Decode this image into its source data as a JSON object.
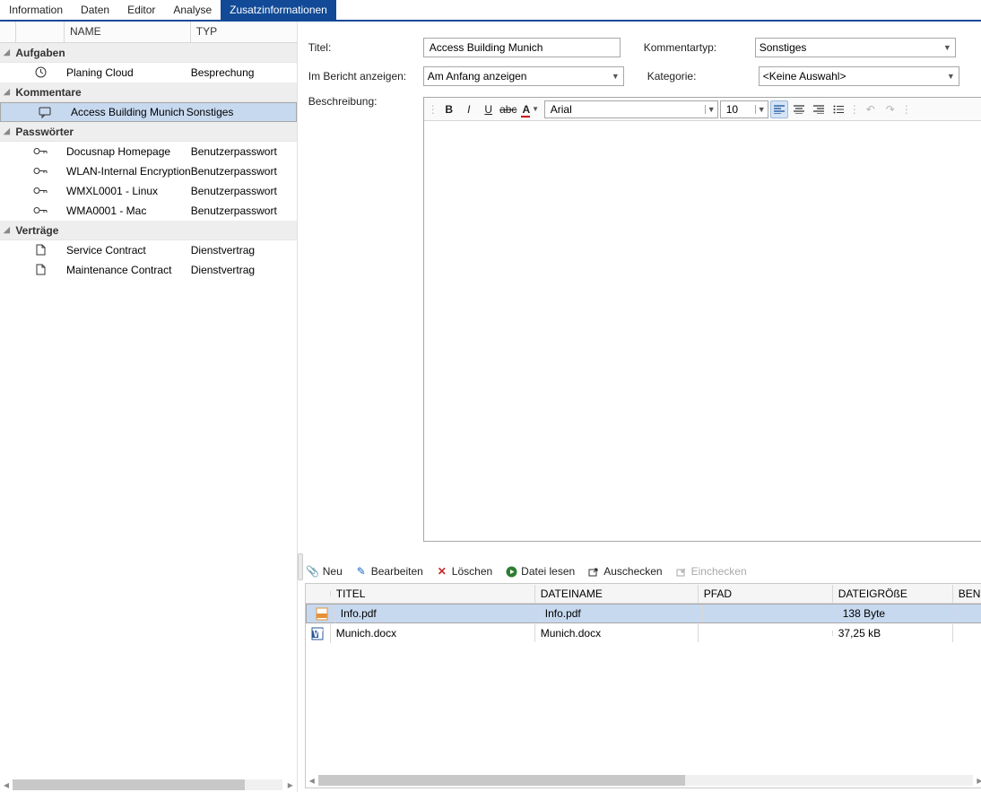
{
  "tabs": {
    "information": "Information",
    "daten": "Daten",
    "editor": "Editor",
    "analyse": "Analyse",
    "zusatz": "Zusatzinformationen"
  },
  "left": {
    "headers": {
      "name": "NAME",
      "typ": "TYP"
    },
    "groups": {
      "aufgaben": {
        "label": "Aufgaben",
        "items": [
          {
            "name": "Planing Cloud",
            "typ": "Besprechung",
            "icon": "clock"
          }
        ]
      },
      "kommentare": {
        "label": "Kommentare",
        "items": [
          {
            "name": "Access Building Munich",
            "typ": "Sonstiges",
            "icon": "comment",
            "selected": true
          }
        ]
      },
      "passwoerter": {
        "label": "Passwörter",
        "items": [
          {
            "name": "Docusnap Homepage",
            "typ": "Benutzerpasswort",
            "icon": "key"
          },
          {
            "name": "WLAN-Internal Encryption",
            "typ": "Benutzerpasswort",
            "icon": "key"
          },
          {
            "name": "WMXL0001 - Linux",
            "typ": "Benutzerpasswort",
            "icon": "key"
          },
          {
            "name": "WMA0001 - Mac",
            "typ": "Benutzerpasswort",
            "icon": "key"
          }
        ]
      },
      "vertraege": {
        "label": "Verträge",
        "items": [
          {
            "name": "Service Contract",
            "typ": "Dienstvertrag",
            "icon": "doc"
          },
          {
            "name": "Maintenance Contract",
            "typ": "Dienstvertrag",
            "icon": "doc"
          }
        ]
      }
    }
  },
  "form": {
    "labels": {
      "titel": "Titel:",
      "kommentartyp": "Kommentartyp:",
      "bericht": "Im Bericht anzeigen:",
      "kategorie": "Kategorie:",
      "beschreibung": "Beschreibung:"
    },
    "values": {
      "titel": "Access Building Munich",
      "kommentartyp": "Sonstiges",
      "bericht": "Am Anfang anzeigen",
      "kategorie": "<Keine Auswahl>"
    },
    "toolbar": {
      "font": "Arial",
      "size": "10"
    }
  },
  "attachments": {
    "toolbar": {
      "neu": "Neu",
      "bearbeiten": "Bearbeiten",
      "loeschen": "Löschen",
      "datei_lesen": "Datei lesen",
      "auschecken": "Auschecken",
      "einchecken": "Einchecken"
    },
    "headers": {
      "titel": "TITEL",
      "dateiname": "DATEINAME",
      "pfad": "PFAD",
      "groesse": "DATEIGRÖßE",
      "ben": "BEN"
    },
    "rows": [
      {
        "titel": "Info.pdf",
        "dateiname": "Info.pdf",
        "pfad": "",
        "groesse": "138 Byte",
        "icon": "pdf",
        "selected": true
      },
      {
        "titel": "Munich.docx",
        "dateiname": "Munich.docx",
        "pfad": "",
        "groesse": "37,25 kB",
        "icon": "docx",
        "selected": false
      }
    ]
  }
}
